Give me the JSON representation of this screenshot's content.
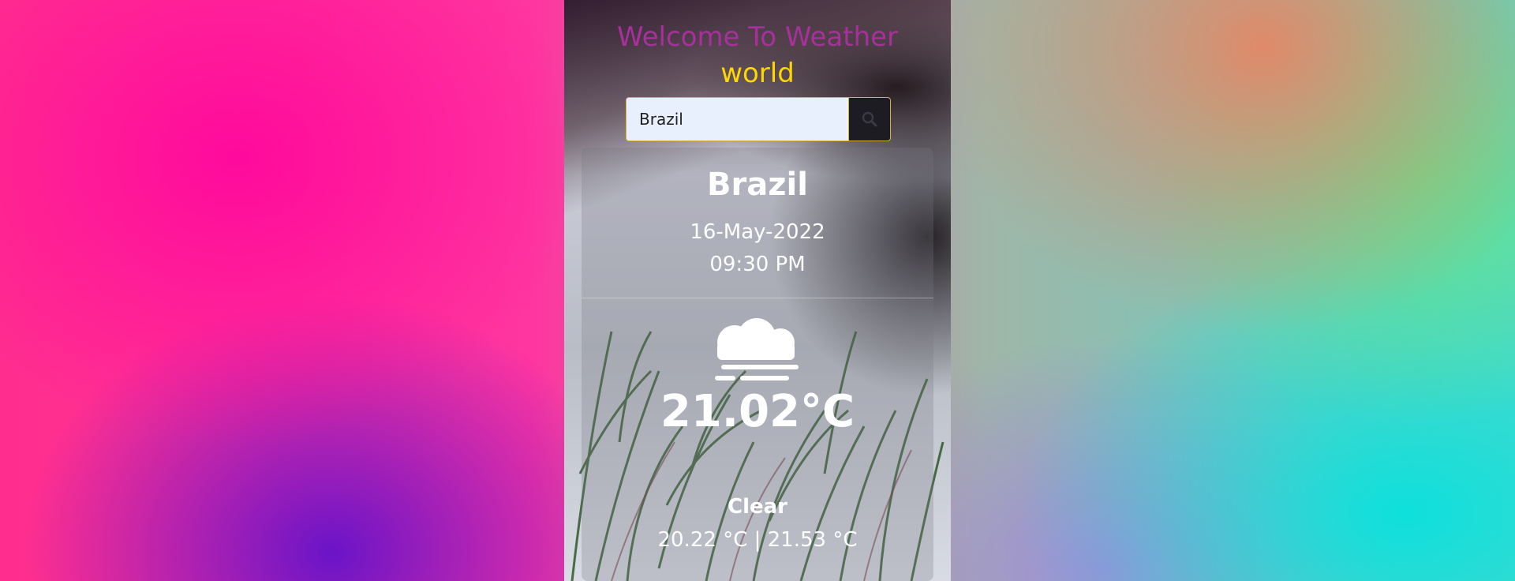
{
  "header": {
    "title_line1": "Welcome To Weather",
    "title_line2": "world"
  },
  "search": {
    "value": "Brazil",
    "button_icon": "search-icon"
  },
  "weather": {
    "city": "Brazil",
    "date": "16-May-2022",
    "time": "09:30 PM",
    "icon": "fog-icon",
    "temperature": "21.02°C",
    "condition": "Clear",
    "range": "20.22 °C | 21.53 °C"
  },
  "colors": {
    "title_primary": "#a7309a",
    "title_secondary": "#ffd700",
    "search_border": "#d6b13c",
    "search_button": "#1c1c22"
  }
}
